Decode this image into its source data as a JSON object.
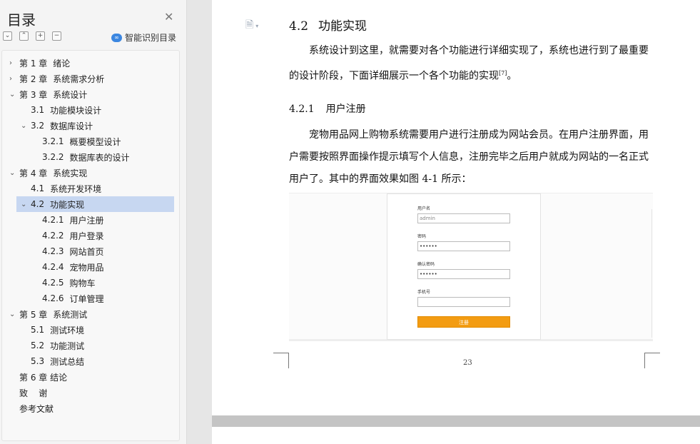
{
  "sidebar": {
    "title": "目录",
    "close_icon": "close-icon",
    "tools": [
      "collapse-all-icon",
      "expand-level-icon",
      "add-icon",
      "remove-icon"
    ],
    "smart_label": "智能识别目录",
    "items": [
      {
        "num": "第 1 章",
        "label": "绪论"
      },
      {
        "num": "第 2 章",
        "label": "系统需求分析"
      },
      {
        "num": "第 3 章",
        "label": "系统设计"
      },
      {
        "num": "3.1",
        "label": "功能模块设计"
      },
      {
        "num": "3.2",
        "label": "数据库设计"
      },
      {
        "num": "3.2.1",
        "label": "概要模型设计"
      },
      {
        "num": "3.2.2",
        "label": "数据库表的设计"
      },
      {
        "num": "第 4 章",
        "label": "系统实现"
      },
      {
        "num": "4.1",
        "label": "系统开发环境"
      },
      {
        "num": "4.2",
        "label": "功能实现"
      },
      {
        "num": "4.2.1",
        "label": "用户注册"
      },
      {
        "num": "4.2.2",
        "label": "用户登录"
      },
      {
        "num": "4.2.3",
        "label": "网站首页"
      },
      {
        "num": "4.2.4",
        "label": "宠物用品"
      },
      {
        "num": "4.2.5",
        "label": "购物车"
      },
      {
        "num": "4.2.6",
        "label": "订单管理"
      },
      {
        "num": "第 5 章",
        "label": "系统测试"
      },
      {
        "num": "5.1",
        "label": "测试环境"
      },
      {
        "num": "5.2",
        "label": "功能测试"
      },
      {
        "num": "5.3",
        "label": "测试总结"
      },
      {
        "num": "",
        "label": "第 6 章  结论"
      },
      {
        "num": "",
        "label": "致    谢"
      },
      {
        "num": "",
        "label": "参考文献"
      }
    ]
  },
  "document": {
    "section_num": "4.2",
    "section_title": "功能实现",
    "para1_a": "系统设计到这里，就需要对各个功能进行详细实现了，系统也进行到了最重要的设计阶段，下面详细展示一个各个功能的实现",
    "para1_ref": "[7]",
    "para1_b": "。",
    "sub_num": "4.2.1",
    "sub_title": "用户注册",
    "para2": "宠物用品网上购物系统需要用户进行注册成为网站会员。在用户注册界面，用户需要按照界面操作提示填写个人信息，注册完毕之后用户就成为网站的一名正式用户了。其中的界面效果如图 4-1 所示：",
    "figure": {
      "username_label": "用户名",
      "username_value": "admin",
      "password_label": "密码",
      "password_value": "••••••",
      "confirm_label": "确认密码",
      "confirm_value": "••••••",
      "phone_label": "手机号",
      "phone_value": "",
      "submit_label": "注册",
      "button_color": "#f39c12"
    },
    "page_number": "23"
  }
}
